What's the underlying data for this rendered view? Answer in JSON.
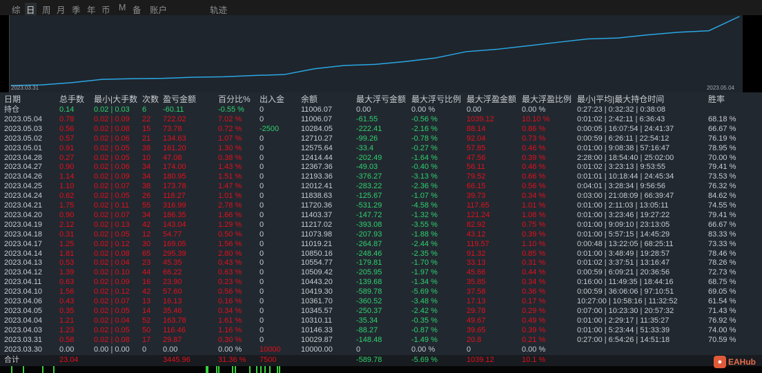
{
  "tabs": [
    "综",
    "日",
    "周",
    "月",
    "季",
    "年",
    "币",
    "M",
    "备",
    "账户",
    "轨迹"
  ],
  "active_tab": "日",
  "chart": {
    "start_label": "2023.03.31",
    "end_label": "2023.05.04",
    "line_color": "#29a8e6",
    "values": [
      0,
      29.87,
      146.33,
      310.11,
      345.57,
      361.7,
      419.3,
      443.2,
      509.42,
      554.77,
      850.16,
      1019.21,
      1073.98,
      1217.02,
      1403.37,
      1720.36,
      1838.63,
      2012.41,
      2193.36,
      2367.36,
      2414.44,
      2575.64,
      2710.27,
      2784.05,
      3506.07
    ]
  },
  "headers": [
    "日期",
    "总手数",
    "最小|大手数",
    "次数",
    "盈亏金额",
    "百分比%",
    "出入金",
    "余额",
    "最大浮亏金额",
    "最大浮亏比例",
    "最大浮盈金额",
    "最大浮盈比例",
    "最小|平均|最大持仓时间",
    "胜率"
  ],
  "colors": {
    "red": "#e3101c",
    "green": "#2fd26e",
    "text": "#c9cdd2",
    "bg": "#222830"
  },
  "rows": [
    {
      "tones": "wgggggwwwwwwww",
      "cells": [
        "持仓",
        "0.14",
        "0.02 | 0.03",
        "6",
        "-60.11",
        "-0.55 %",
        "0",
        "11006.07",
        "0.00",
        "0.00 %",
        "0.00",
        "0.00 %",
        "0:27:23 | 0:32:32 | 0:38:08",
        ""
      ]
    },
    {
      "tones": "wrrrrrwwggrrww",
      "cells": [
        "2023.05.04",
        "0.78",
        "0.02 | 0.09",
        "22",
        "722.02",
        "7.02 %",
        "0",
        "11006.07",
        "-61.55",
        "-0.56 %",
        "1039.12",
        "10.10 %",
        "0:01:02 | 2:42:11 | 6:36:43",
        "68.18 %"
      ]
    },
    {
      "tones": "wrrrrrgwggrrww",
      "cells": [
        "2023.05.03",
        "0.56",
        "0.02 | 0.08",
        "15",
        "73.78",
        "0.72 %",
        "-2500",
        "10284.05",
        "-222.41",
        "-2.16 %",
        "88.14",
        "0.86 %",
        "0:00:05 | 16:07:54 | 24:41:37",
        "66.67 %"
      ]
    },
    {
      "tones": "wrrrrrwwggrrww",
      "cells": [
        "2023.05.02",
        "0.57",
        "0.02 | 0.06",
        "21",
        "134.63",
        "1.07 %",
        "0",
        "12710.27",
        "-99.26",
        "-0.78 %",
        "92.04",
        "0.73 %",
        "0:00:59 | 6:26:11 | 22:54:12",
        "76.19 %"
      ]
    },
    {
      "tones": "wrrrrrwwggrrww",
      "cells": [
        "2023.05.01",
        "0.91",
        "0.02 | 0.05",
        "38",
        "161.20",
        "1.30 %",
        "0",
        "12575.64",
        "-33.4",
        "-0.27 %",
        "57.85",
        "0.46 %",
        "0:01:00 | 9:08:38 | 57:16:47",
        "78.95 %"
      ]
    },
    {
      "tones": "wrrrrrwwggrrww",
      "cells": [
        "2023.04.28",
        "0.27",
        "0.02 | 0.05",
        "10",
        "47.08",
        "0.38 %",
        "0",
        "12414.44",
        "-202.49",
        "-1.64 %",
        "47.56",
        "0.39 %",
        "2:28:00 | 18:54:40 | 25:02:00",
        "70.00 %"
      ]
    },
    {
      "tones": "wrrrrrwwggrrww",
      "cells": [
        "2023.04.27",
        "0.90",
        "0.02 | 0.06",
        "34",
        "174.00",
        "1.43 %",
        "0",
        "12367.36",
        "-49.03",
        "-0.40 %",
        "56.11",
        "0.46 %",
        "0:01:02 | 3:23:13 | 9:53:55",
        "79.41 %"
      ]
    },
    {
      "tones": "wrrrrrwwggrrww",
      "cells": [
        "2023.04.26",
        "1.14",
        "0.02 | 0.09",
        "34",
        "180.95",
        "1.51 %",
        "0",
        "12193.36",
        "-376.27",
        "-3.13 %",
        "79.52",
        "0.66 %",
        "0:01:01 | 10:18:44 | 24:45:34",
        "73.53 %"
      ]
    },
    {
      "tones": "wrrrrrwwggrrww",
      "cells": [
        "2023.04.25",
        "1.10",
        "0.02 | 0.07",
        "38",
        "173.78",
        "1.47 %",
        "0",
        "12012.41",
        "-283.22",
        "-2.36 %",
        "66.15",
        "0.56 %",
        "0:04:01 | 3:28:34 | 9:56:56",
        "76.32 %"
      ]
    },
    {
      "tones": "wrrrrrwwggrrww",
      "cells": [
        "2023.04.24",
        "0.62",
        "0.02 | 0.05",
        "26",
        "118.27",
        "1.01 %",
        "0",
        "11838.63",
        "-125.67",
        "-1.07 %",
        "39.73",
        "0.34 %",
        "0:03:00 | 21:08:09 | 66:39:47",
        "84.62 %"
      ]
    },
    {
      "tones": "wrrrrrwwggrrww",
      "cells": [
        "2023.04.21",
        "1.75",
        "0.02 | 0.11",
        "55",
        "316.99",
        "2.78 %",
        "0",
        "11720.36",
        "-531.29",
        "-4.58 %",
        "117.65",
        "1.01 %",
        "0:01:00 | 2:11:03 | 13:05:11",
        "74.55 %"
      ]
    },
    {
      "tones": "wrrrrrwwggrrww",
      "cells": [
        "2023.04.20",
        "0.90",
        "0.02 | 0.07",
        "34",
        "186.35",
        "1.66 %",
        "0",
        "11403.37",
        "-147.72",
        "-1.32 %",
        "121.24",
        "1.08 %",
        "0:01:00 | 3:23:46 | 19:27:22",
        "79.41 %"
      ]
    },
    {
      "tones": "wrrrrrwwggrrww",
      "cells": [
        "2023.04.19",
        "2.12",
        "0.02 | 0.13",
        "42",
        "143.04",
        "1.29 %",
        "0",
        "11217.02",
        "-393.08",
        "-3.55 %",
        "82.92",
        "0.75 %",
        "0:01:00 | 9:09:10 | 23:13:05",
        "66.67 %"
      ]
    },
    {
      "tones": "wrrrrrwwggrrww",
      "cells": [
        "2023.04.18",
        "0.31",
        "0.02 | 0.05",
        "12",
        "54.77",
        "0.50 %",
        "0",
        "11073.98",
        "-207.93",
        "-1.88 %",
        "43.12",
        "0.39 %",
        "0:01:00 | 5:57:15 | 14:45:29",
        "83.33 %"
      ]
    },
    {
      "tones": "wrrrrrwwggrrww",
      "cells": [
        "2023.04.17",
        "1.25",
        "0.02 | 0.12",
        "30",
        "169.05",
        "1.56 %",
        "0",
        "11019.21",
        "-264.87",
        "-2.44 %",
        "119.57",
        "1.10 %",
        "0:00:48 | 13:22:05 | 68:25:11",
        "73.33 %"
      ]
    },
    {
      "tones": "wrrrrrwwggrrww",
      "cells": [
        "2023.04.14",
        "1.81",
        "0.02 | 0.08",
        "65",
        "295.39",
        "2.80 %",
        "0",
        "10850.16",
        "-248.46",
        "-2.35 %",
        "91.32",
        "0.85 %",
        "0:01:00 | 3:48:49 | 19:28:57",
        "78.46 %"
      ]
    },
    {
      "tones": "wrrrrrwwggrrww",
      "cells": [
        "2023.04.13",
        "0.53",
        "0.02 | 0.04",
        "23",
        "45.35",
        "0.43 %",
        "0",
        "10554.77",
        "-179.81",
        "-1.70 %",
        "33.13",
        "0.31 %",
        "0:01:02 | 3:37:51 | 13:16:47",
        "78.26 %"
      ]
    },
    {
      "tones": "wrrrrrwwggrrww",
      "cells": [
        "2023.04.12",
        "1.39",
        "0.02 | 0.10",
        "44",
        "66.22",
        "0.63 %",
        "0",
        "10509.42",
        "-205.95",
        "-1.97 %",
        "45.66",
        "0.44 %",
        "0:00:59 | 6:09:21 | 20:36:56",
        "72.73 %"
      ]
    },
    {
      "tones": "wrrrrrwwggrrww",
      "cells": [
        "2023.04.11",
        "0.63",
        "0.02 | 0.09",
        "16",
        "23.90",
        "0.23 %",
        "0",
        "10443.20",
        "-139.68",
        "-1.34 %",
        "35.85",
        "0.34 %",
        "0:16:00 | 11:49:35 | 18:44:16",
        "68.75 %"
      ]
    },
    {
      "tones": "wrrrrrwwggrrww",
      "cells": [
        "2023.04.10",
        "1.56",
        "0.02 | 0.12",
        "42",
        "57.60",
        "0.56 %",
        "0",
        "10419.30",
        "-589.78",
        "-5.69 %",
        "37.58",
        "0.36 %",
        "0:00:59 | 36:06:06 | 97:10:51",
        "69.05 %"
      ]
    },
    {
      "tones": "wrrrrrwwggrrww",
      "cells": [
        "2023.04.06",
        "0.43",
        "0.02 | 0.07",
        "13",
        "16.13",
        "0.16 %",
        "0",
        "10361.70",
        "-360.52",
        "-3.48 %",
        "17.13",
        "0.17 %",
        "10:27:00 | 10:58:16 | 11:32:52",
        "61.54 %"
      ]
    },
    {
      "tones": "wrrrrrwwggrrww",
      "cells": [
        "2023.04.05",
        "0.35",
        "0.02 | 0.05",
        "14",
        "35.46",
        "0.34 %",
        "0",
        "10345.57",
        "-250.37",
        "-2.42 %",
        "29.78",
        "0.29 %",
        "0:07:00 | 10:23:30 | 20:57:32",
        "71.43 %"
      ]
    },
    {
      "tones": "wrrrrrwwggrrww",
      "cells": [
        "2023.04.04",
        "1.21",
        "0.02 | 0.04",
        "52",
        "163.78",
        "1.61 %",
        "0",
        "10310.11",
        "-35.34",
        "-0.35 %",
        "49.67",
        "0.49 %",
        "0:01:00 | 2:29:17 | 11:35:27",
        "76.92 %"
      ]
    },
    {
      "tones": "wrrrrrwwggrrww",
      "cells": [
        "2023.04.03",
        "1.23",
        "0.02 | 0.05",
        "50",
        "116.46",
        "1.16 %",
        "0",
        "10146.33",
        "-88.27",
        "-0.87 %",
        "39.65",
        "0.39 %",
        "0:01:00 | 5:23:44 | 51:33:39",
        "74.00 %"
      ]
    },
    {
      "tones": "wrrrrrwwggrrww",
      "cells": [
        "2023.03.31",
        "0.58",
        "0.02 | 0.08",
        "17",
        "29.87",
        "0.30 %",
        "0",
        "10029.87",
        "-148.48",
        "-1.49 %",
        "20.8",
        "0.21 %",
        "0:27:00 | 6:54:26 | 14:51:18",
        "70.59 %"
      ]
    },
    {
      "tones": "wwwwwwrwwwwwww",
      "cells": [
        "2023.03.30",
        "0.00",
        "0.00 | 0.00",
        "0",
        "0.00",
        "0.00 %",
        "10000",
        "10000.00",
        "0",
        "0.00 %",
        "0",
        "0.00 %",
        "",
        ""
      ]
    }
  ],
  "total": {
    "tones": "wrwwrrrwggrrww",
    "cells": [
      "合计",
      "23.04",
      "",
      "",
      "3445.96",
      "31.36 %",
      "7500",
      "",
      "-589.78",
      "-5.69 %",
      "1039.12",
      "10.1 %",
      "",
      ""
    ]
  },
  "logo": {
    "text": "EAHub"
  }
}
